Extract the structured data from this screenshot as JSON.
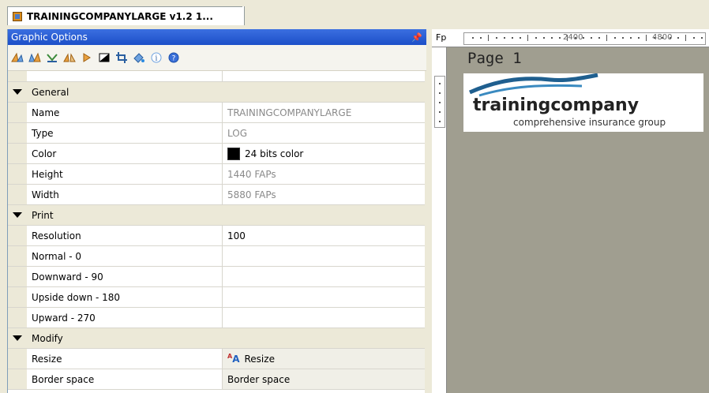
{
  "document_tab": {
    "title": "TRAININGCOMPANYLARGE v1.2 1..."
  },
  "panel": {
    "title": "Graphic Options",
    "toolbar_icons": [
      "rotate-left-icon",
      "rotate-right-icon",
      "flip-icon",
      "mirror-icon",
      "arrow-right-icon",
      "invert-icon",
      "crop-icon",
      "fill-icon",
      "info-icon",
      "help-icon"
    ]
  },
  "properties": {
    "general": {
      "label": "General",
      "name": {
        "label": "Name",
        "value": "TRAININGCOMPANYLARGE"
      },
      "type": {
        "label": "Type",
        "value": "LOG"
      },
      "color": {
        "label": "Color",
        "value": "24 bits color",
        "swatch": "#000000"
      },
      "height": {
        "label": "Height",
        "value": "1440 FAPs"
      },
      "width": {
        "label": "Width",
        "value": "5880 FAPs"
      }
    },
    "print": {
      "label": "Print",
      "resolution": {
        "label": "Resolution",
        "value": "100"
      },
      "normal": {
        "label": "Normal - 0",
        "value": ""
      },
      "downward": {
        "label": "Downward - 90",
        "value": ""
      },
      "upside_down": {
        "label": "Upside down - 180",
        "value": ""
      },
      "upward": {
        "label": "Upward - 270",
        "value": ""
      }
    },
    "modify": {
      "label": "Modify",
      "resize": {
        "label": "Resize",
        "value": "Resize"
      },
      "border_space": {
        "label": "Border space",
        "value": "Border space"
      }
    }
  },
  "designer": {
    "fp_label": "Fp",
    "ruler_labels": [
      "2400",
      "4800"
    ],
    "page_label": "Page 1",
    "logo": {
      "main": "trainingcompany",
      "sub": "comprehensive insurance group"
    }
  },
  "colors": {
    "title_bar": "#2a5fd8",
    "designer_bg": "#a09e90",
    "logo_wave": "#1f5f8f"
  }
}
